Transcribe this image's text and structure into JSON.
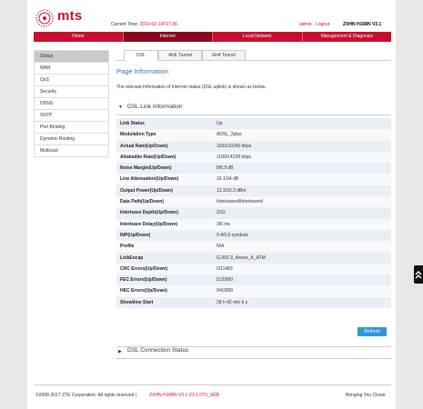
{
  "brand": {
    "logo_text": "mts"
  },
  "header": {
    "time_label": "Current Time:",
    "time_value": "2019-02-14T07:36",
    "user": "admin",
    "logout": "Logout",
    "model": "ZXHN H168N V3.1"
  },
  "nav": [
    "Home",
    "Internet",
    "Local Network",
    "Management & Diagnosis"
  ],
  "sidebar": [
    "Status",
    "WAN",
    "QoS",
    "Security",
    "DDNS",
    "SNTP",
    "Port Binding",
    "Dynamic Routing",
    "Multicast"
  ],
  "tabs": [
    "DSL",
    "4in6 Tunnel",
    "6in4 Tunnel"
  ],
  "page": {
    "title": "Page Information",
    "description": "The relevant information of Internet status (DSL uplink) is shown as below."
  },
  "section1": {
    "title": "DSL Link Information"
  },
  "section2": {
    "title": "DSL Connection Status"
  },
  "dsl_info": [
    {
      "label": "Link Status",
      "value": "Up"
    },
    {
      "label": "Modulation Type",
      "value": "ADSL_2plus"
    },
    {
      "label": "Actual Rate(Up/Down)",
      "value": "1020/10240 kbps"
    },
    {
      "label": "Attainable Rate(Up/Down)",
      "value": "1100/14228 kbps"
    },
    {
      "label": "Noise Margin(Up/Down)",
      "value": "8/8.9 dB"
    },
    {
      "label": "Line Attenuation(Up/Down)",
      "value": "16.1/34 dB"
    },
    {
      "label": "Output Power(Up/Down)",
      "value": "12.3/16.3 dBm"
    },
    {
      "label": "Data Path(Up/Down)",
      "value": "Interleaved/Interleaved"
    },
    {
      "label": "Interleave Depth(Up/Down)",
      "value": "2/32"
    },
    {
      "label": "Interleave Delay(Up/Down)",
      "value": "3/6 ms"
    },
    {
      "label": "INP(Up/Down)",
      "value": "0.4/0.6 symbols"
    },
    {
      "label": "Profile",
      "value": "N/A"
    },
    {
      "label": "LinkEncap",
      "value": "G.992.3_Annex_K_ATM"
    },
    {
      "label": "CRC Errors(Up/Down)",
      "value": "0/11483"
    },
    {
      "label": "FEC Errors(Up/Down)",
      "value": "51208/0"
    },
    {
      "label": "HEC Errors(Up/Down)",
      "value": "0/43999"
    },
    {
      "label": "Showtime Start",
      "value": "28 h 42 min 6 s"
    }
  ],
  "refresh_label": "Refresh",
  "footer": {
    "copyright": "©2008-2017 ZTE Corporation. All rights reserved  |",
    "firmware": "ZXHN H168N V3.1 V3.1.0T9_SRB",
    "slogan": "Bringing You Closer"
  },
  "scroll_top_icon": "double-chevron-up-icon",
  "colors": {
    "brand_red": "#c8102e",
    "title_blue": "#3d6e9c",
    "button_blue": "#2f97d8"
  }
}
